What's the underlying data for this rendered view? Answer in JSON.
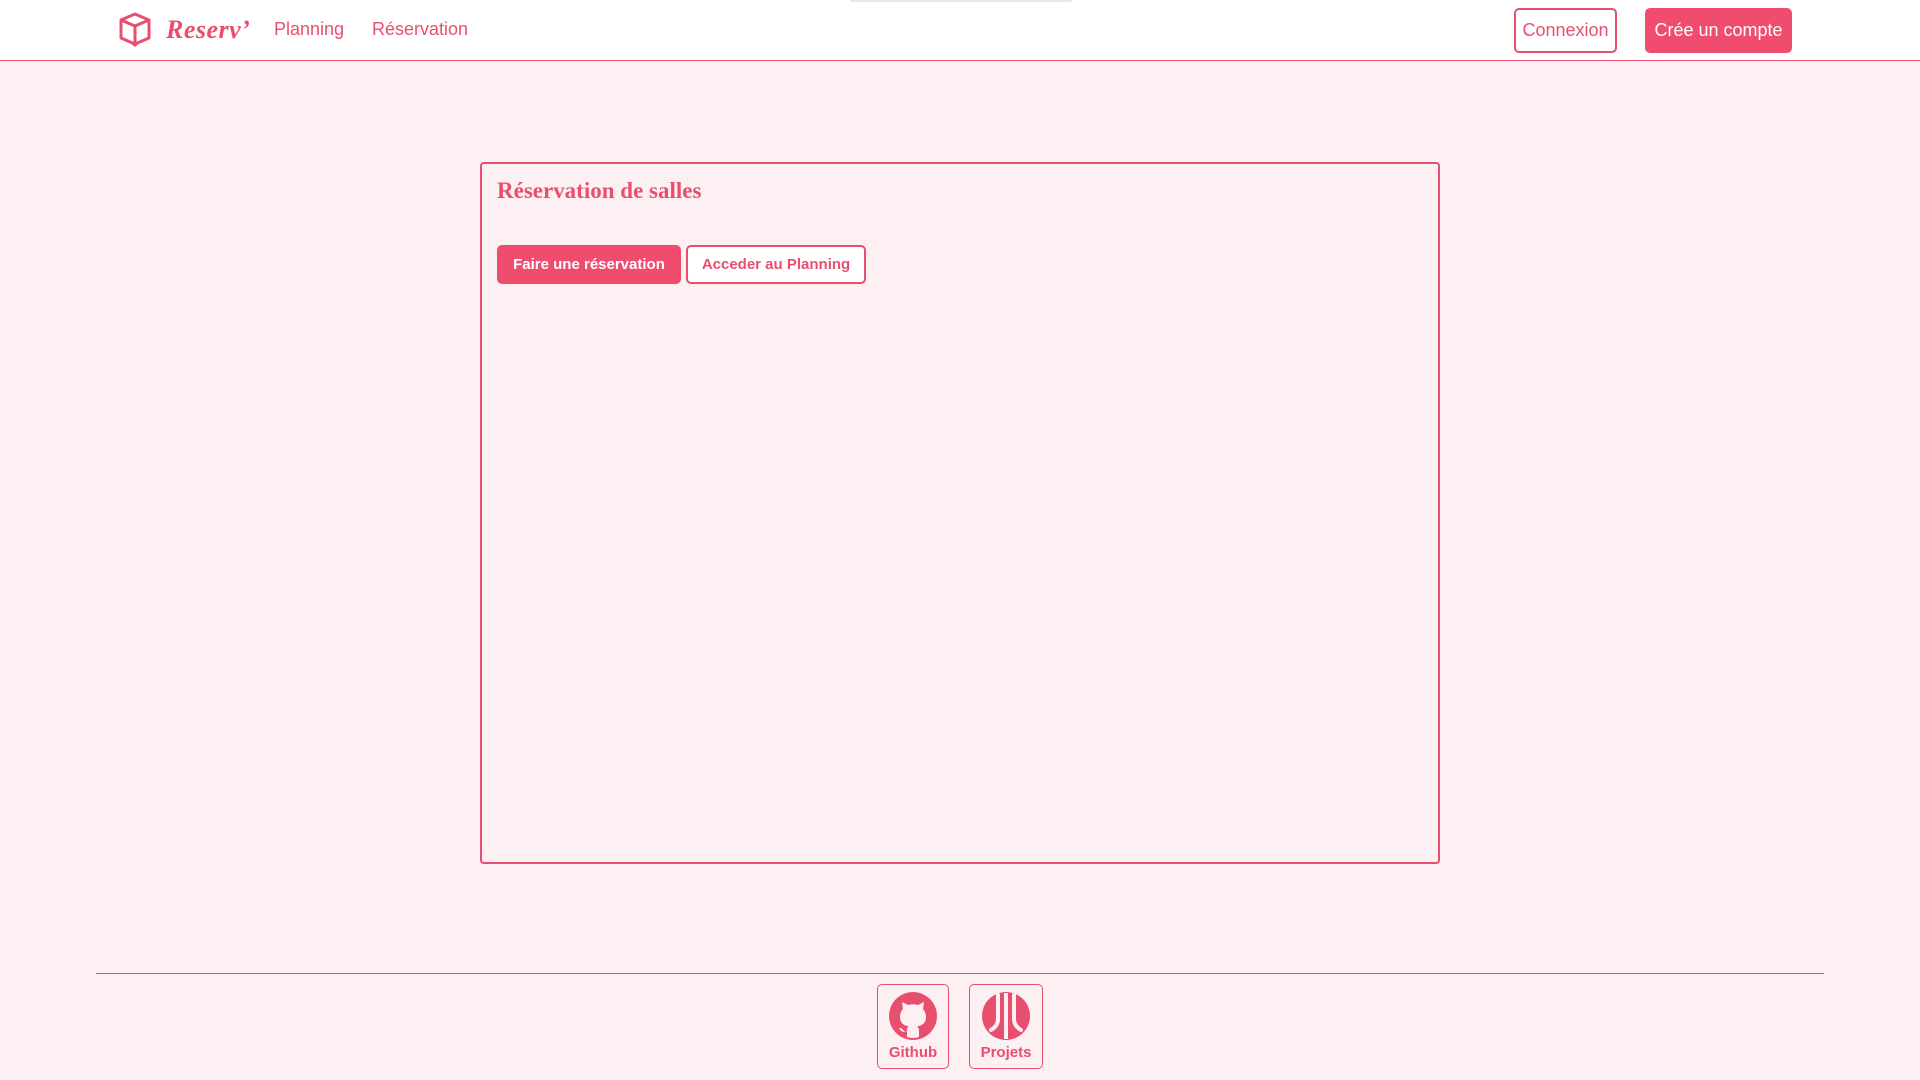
{
  "header": {
    "brand_name": "Reserv’",
    "nav": {
      "planning": "Planning",
      "reservation": "Réservation"
    },
    "login_label": "Connexion",
    "signup_label": "Crée un compte"
  },
  "main": {
    "title": "Réservation de salles",
    "reserve_button": "Faire une réservation",
    "planning_button": "Acceder au Planning"
  },
  "footer": {
    "github_label": "Github",
    "projects_label": "Projets"
  },
  "icons": {
    "brand": "box-logo-icon",
    "github": "github-icon",
    "projects": "projects-logo-icon"
  },
  "colors": {
    "accent": "#f04d6e",
    "background": "#fcf0f2",
    "header_background": "#ffffff"
  }
}
